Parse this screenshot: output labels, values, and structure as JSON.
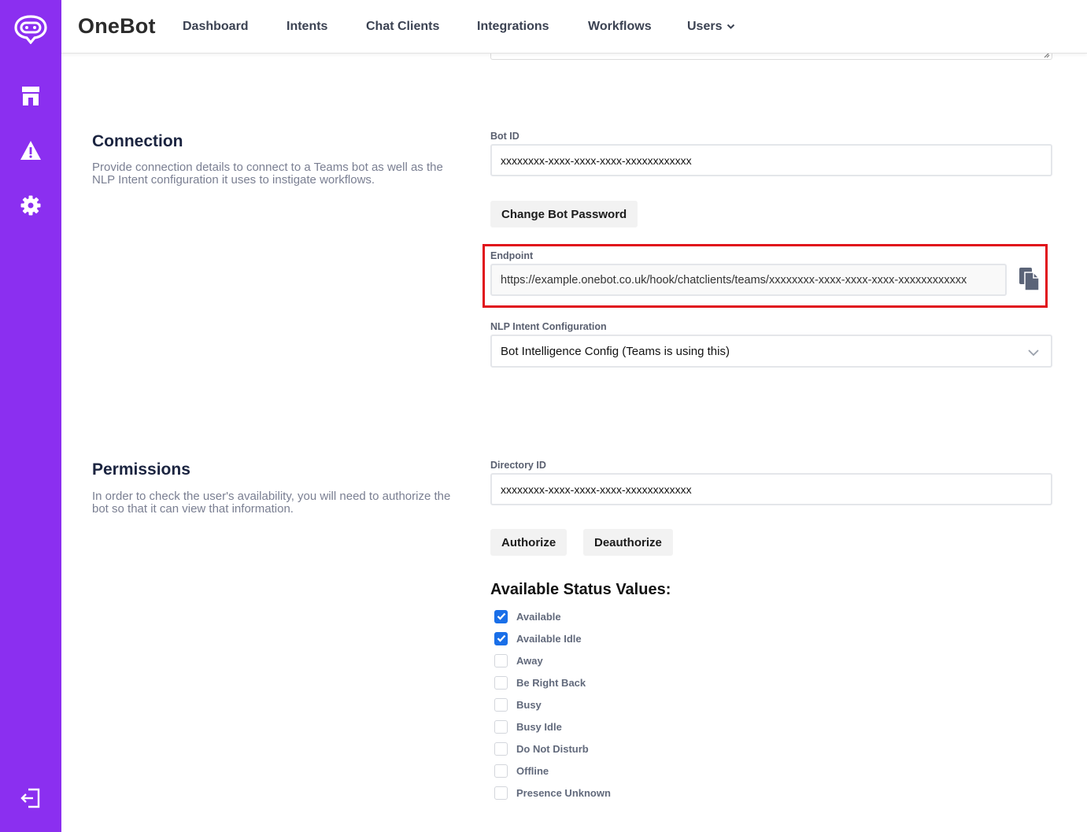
{
  "app": {
    "brand": "OneBot"
  },
  "nav": {
    "items": [
      {
        "label": "Dashboard"
      },
      {
        "label": "Intents"
      },
      {
        "label": "Chat Clients"
      },
      {
        "label": "Integrations"
      },
      {
        "label": "Workflows"
      },
      {
        "label": "Users"
      }
    ]
  },
  "sidebar": {
    "icons": [
      "chat-bot-logo-icon",
      "store-icon",
      "warning-icon",
      "gear-icon",
      "logout-icon"
    ]
  },
  "connection": {
    "title": "Connection",
    "description": "Provide connection details to connect to a Teams bot as well as the NLP Intent configuration it uses to instigate workflows.",
    "bot_id_label": "Bot ID",
    "bot_id_value": "xxxxxxxx-xxxx-xxxx-xxxx-xxxxxxxxxxxx",
    "change_password_label": "Change Bot Password",
    "endpoint_label": "Endpoint",
    "endpoint_value": "https://example.onebot.co.uk/hook/chatclients/teams/xxxxxxxx-xxxx-xxxx-xxxx-xxxxxxxxxxxx",
    "nlp_label": "NLP Intent Configuration",
    "nlp_value": "Bot Intelligence Config (Teams is using this)"
  },
  "permissions": {
    "title": "Permissions",
    "description": "In order to check the user's availability, you will need to authorize the bot so that it can view that information.",
    "directory_id_label": "Directory ID",
    "directory_id_value": "xxxxxxxx-xxxx-xxxx-xxxx-xxxxxxxxxxxx",
    "authorize_label": "Authorize",
    "deauthorize_label": "Deauthorize",
    "status_heading": "Available Status Values:",
    "statuses": [
      {
        "label": "Available",
        "checked": true
      },
      {
        "label": "Available Idle",
        "checked": true
      },
      {
        "label": "Away",
        "checked": false
      },
      {
        "label": "Be Right Back",
        "checked": false
      },
      {
        "label": "Busy",
        "checked": false
      },
      {
        "label": "Busy Idle",
        "checked": false
      },
      {
        "label": "Do Not Disturb",
        "checked": false
      },
      {
        "label": "Offline",
        "checked": false
      },
      {
        "label": "Presence Unknown",
        "checked": false
      }
    ]
  },
  "colors": {
    "sidebar": "#8b2ff0",
    "accent": "#1a6fe8",
    "highlight": "#e0101a"
  }
}
